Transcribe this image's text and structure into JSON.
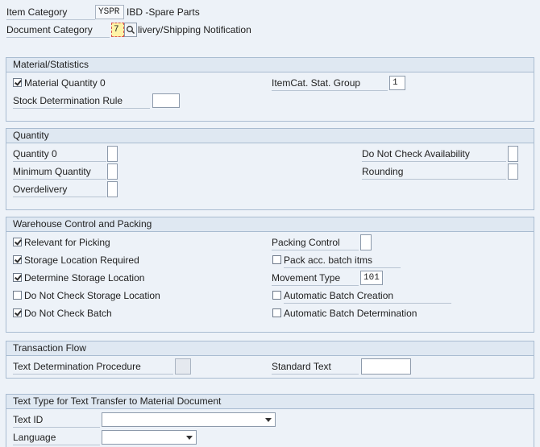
{
  "header": {
    "item_category_label": "Item Category",
    "item_category_value": "YSPR",
    "item_category_desc": "IBD -Spare Parts",
    "document_category_label": "Document Category",
    "document_category_value": "7",
    "document_category_desc": "Delivery/Shipping Notification",
    "document_category_desc_visible": "livery/Shipping Notification"
  },
  "material_statistics": {
    "title": "Material/Statistics",
    "material_quantity_0": {
      "label": "Material Quantity 0",
      "checked": true
    },
    "itemcat_stat_group": {
      "label": "ItemCat. Stat. Group",
      "value": "1"
    },
    "stock_determination_rule": {
      "label": "Stock Determination Rule",
      "value": ""
    }
  },
  "quantity": {
    "title": "Quantity",
    "quantity_0": {
      "label": "Quantity 0",
      "value": ""
    },
    "minimum_quantity": {
      "label": "Minimum Quantity",
      "value": ""
    },
    "overdelivery": {
      "label": "Overdelivery",
      "value": ""
    },
    "do_not_check_availability": {
      "label": "Do Not Check Availability",
      "value": ""
    },
    "rounding": {
      "label": "Rounding",
      "value": ""
    }
  },
  "warehouse": {
    "title": "Warehouse Control and Packing",
    "relevant_for_picking": {
      "label": "Relevant for Picking",
      "checked": true
    },
    "storage_location_required": {
      "label": "Storage Location Required",
      "checked": true
    },
    "determine_storage_location": {
      "label": "Determine Storage Location",
      "checked": true
    },
    "do_not_check_storage_location": {
      "label": "Do Not Check Storage Location",
      "checked": false
    },
    "do_not_check_batch": {
      "label": "Do Not Check Batch",
      "checked": true
    },
    "packing_control": {
      "label": "Packing Control",
      "value": ""
    },
    "pack_acc_batch_itms": {
      "label": "Pack acc. batch itms",
      "checked": false
    },
    "movement_type": {
      "label": "Movement Type",
      "value": "101"
    },
    "automatic_batch_creation": {
      "label": "Automatic Batch Creation",
      "checked": false
    },
    "automatic_batch_determination": {
      "label": "Automatic Batch Determination",
      "checked": false
    }
  },
  "transaction_flow": {
    "title": "Transaction Flow",
    "text_determination_procedure": {
      "label": "Text Determination Procedure",
      "value": ""
    },
    "standard_text": {
      "label": "Standard Text",
      "value": ""
    }
  },
  "text_type": {
    "title": "Text Type for Text Transfer to Material Document",
    "text_id": {
      "label": "Text ID",
      "value": ""
    },
    "language": {
      "label": "Language",
      "value": ""
    }
  },
  "colors": {
    "background": "#edf2f8",
    "section_header": "#dfe8f2",
    "section_border": "#a9bcd1",
    "focus_field": "#fff3a6",
    "focus_border": "#d9534f"
  }
}
